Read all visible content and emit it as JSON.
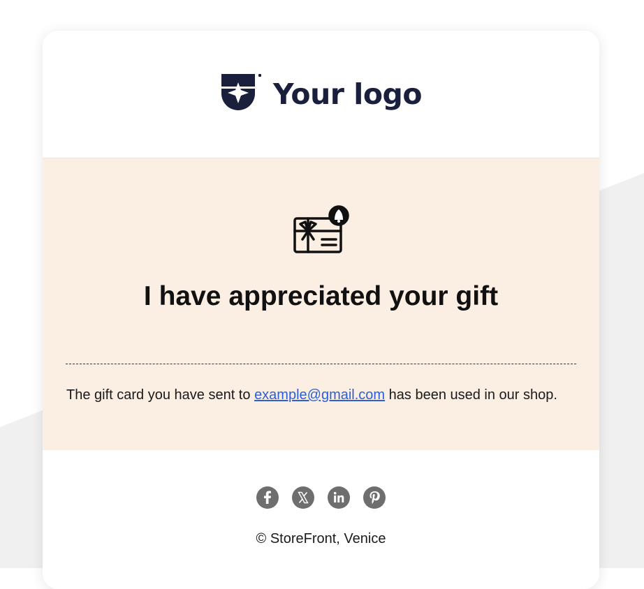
{
  "logo": {
    "text": "Your logo",
    "icon": "logo-mark-icon",
    "color": "#1a1f3c"
  },
  "hero": {
    "icon": "gift-card-icon",
    "headline": "I have appreciated your gift",
    "message_before": "The gift card you have sent to",
    "email": "example@gmail.com",
    "message_after": "has been used in our shop.",
    "background": "#fbeee3"
  },
  "footer": {
    "socials": [
      {
        "name": "facebook-icon"
      },
      {
        "name": "x-icon"
      },
      {
        "name": "linkedin-icon"
      },
      {
        "name": "pinterest-icon"
      }
    ],
    "copyright": "© StoreFront, Venice"
  },
  "colors": {
    "link": "#2b5fd9",
    "social": "#6e6e6e"
  }
}
